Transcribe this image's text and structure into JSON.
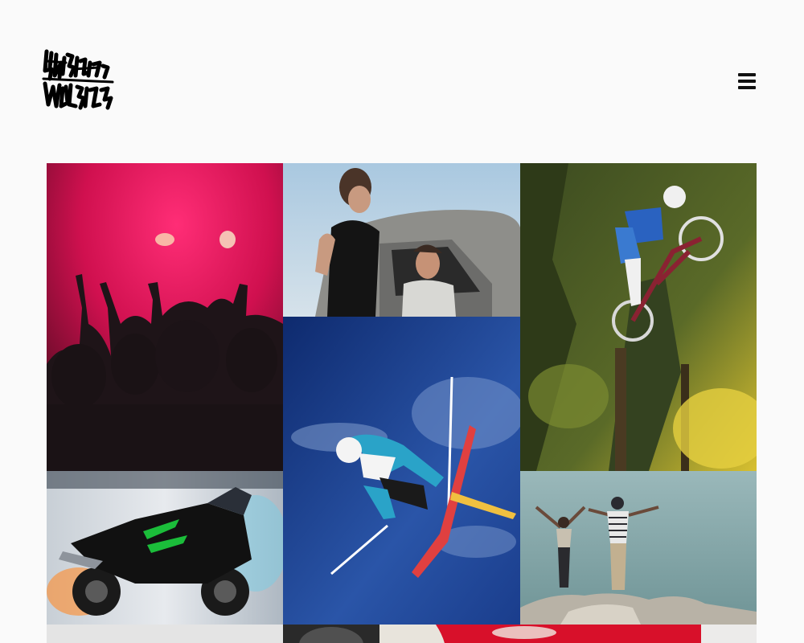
{
  "header": {
    "logo_icon": "graffiti-logo",
    "menu_icon": "hamburger-menu-icon"
  },
  "gallery": {
    "tiles": [
      {
        "subject": "concert-crowd",
        "accent": "#e0105a"
      },
      {
        "subject": "couple-in-car",
        "accent": "#9fc0da"
      },
      {
        "subject": "mountain-biker",
        "accent": "#4e5a24"
      },
      {
        "subject": "freestyle-skier",
        "accent": "#1e3d8f"
      },
      {
        "subject": "motorcycle-burnout",
        "accent": "#1bbd3a"
      },
      {
        "subject": "couple-on-cliff",
        "accent": "#7ea3a5"
      },
      {
        "subject": "empty-placeholder",
        "accent": "#e4e4e4"
      },
      {
        "subject": "cropped-photo-red",
        "accent": "#d8102a"
      }
    ]
  },
  "colors": {
    "background": "#fafafa",
    "icon": "#111111"
  }
}
